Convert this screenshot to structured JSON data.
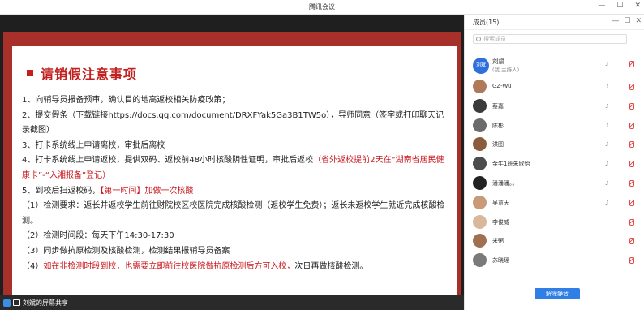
{
  "window": {
    "title": "腾讯会议",
    "minimize": "—",
    "maximize": "☐",
    "close": "✕"
  },
  "slide": {
    "heading": "请销假注意事项",
    "lines": [
      {
        "parts": [
          {
            "text": "1、向辅导员报备预审，确认目的地高返校相关防疫政策；",
            "red": false
          }
        ]
      },
      {
        "parts": [
          {
            "text": "2、提交假条（下载链接https://docs.qq.com/document/DRXFYak5Ga3B1TW5o），导师同意（签字或打印聊天记录截图）",
            "red": false
          }
        ]
      },
      {
        "parts": [
          {
            "text": "3、打卡系统线上申请离校，审批后离校",
            "red": false
          }
        ]
      },
      {
        "parts": [
          {
            "text": "4、打卡系统线上申请返校，提供双码、返校前48小时核酸阴性证明，审批后返校",
            "red": false
          },
          {
            "text": "（省外返校提前2天在“湖南省居民健康卡”-“入湘报备”登记）",
            "red": true
          }
        ]
      },
      {
        "parts": [
          {
            "text": "5、到校后扫返校码，",
            "red": false
          },
          {
            "text": "【第一时间】加做一次核酸",
            "red": true
          }
        ]
      },
      {
        "parts": [
          {
            "text": "（1）检测要求：返长并返校学生前往财院校区校医院完成核酸检测（返校学生免费）；返长未返校学生就近完成核酸检测。",
            "red": false
          }
        ]
      },
      {
        "parts": [
          {
            "text": "（2）检测时间段：每天下午14:30-17:30",
            "red": false
          }
        ]
      },
      {
        "parts": [
          {
            "text": "（3）同步做抗原检测及核酸检测，检测结果报辅导员备案",
            "red": false
          }
        ]
      },
      {
        "parts": [
          {
            "text": "（4）",
            "red": false
          },
          {
            "text": "如在非检测时段到校，也需要立即前往校医院做抗原检测后方可入校，",
            "red": true
          },
          {
            "text": "次日再做核酸检测。",
            "red": false
          }
        ]
      }
    ]
  },
  "share_tag": "刘斌的屏幕共享",
  "panel": {
    "label": "成员(15)",
    "search_placeholder": "搜索成员",
    "host": {
      "avatar_text": "刘斌",
      "name": "刘斌",
      "role": "(我,主持人)"
    },
    "members": [
      {
        "name": "GZ-Wu",
        "muted": true
      },
      {
        "name": "蔡嘉",
        "muted": true
      },
      {
        "name": "陈彬",
        "muted": true
      },
      {
        "name": "洪图",
        "muted": true
      },
      {
        "name": "金牛1班朱欣怡",
        "muted": true
      },
      {
        "name": "潘潘潘。。",
        "muted": true
      },
      {
        "name": "吴意天",
        "muted": true
      },
      {
        "name": "李俊威",
        "muted": false
      },
      {
        "name": "米粥",
        "muted": false
      },
      {
        "name": "苏晓瑶",
        "muted": false
      }
    ],
    "unmute_all": "解除静音"
  },
  "colors": {
    "accent": "#2f7fe6",
    "slide_border": "#a8302a",
    "heading_red": "#c21f1f"
  }
}
